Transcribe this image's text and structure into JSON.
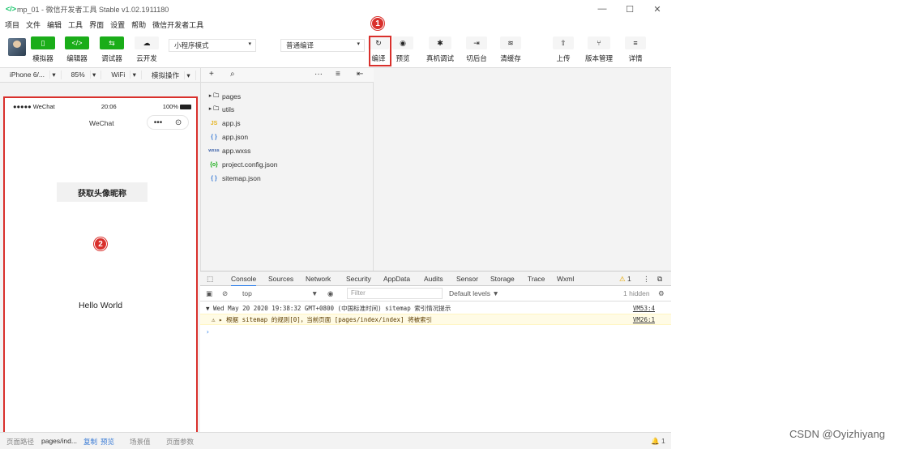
{
  "window": {
    "title": "mp_01 - 微信开发者工具 Stable v1.02.1911180",
    "logo": "</>",
    "controls": [
      "—",
      "☐",
      "✕"
    ]
  },
  "menu": [
    "项目",
    "文件",
    "编辑",
    "工具",
    "界面",
    "设置",
    "帮助",
    "微信开发者工具"
  ],
  "toolbar": {
    "buttons": [
      {
        "label": "模拟器",
        "icon": "phone-icon",
        "glyph": "▯"
      },
      {
        "label": "编辑器",
        "icon": "code-icon",
        "glyph": "</>"
      },
      {
        "label": "调试器",
        "icon": "debug-icon",
        "glyph": "⇆"
      },
      {
        "label": "云开发",
        "icon": "cloud-icon",
        "glyph": "☁"
      }
    ],
    "mode_select": "小程序模式",
    "compile_select": "普通编译",
    "actions": [
      {
        "label": "编译",
        "icon": "refresh-icon",
        "glyph": "↻"
      },
      {
        "label": "预览",
        "icon": "eye-icon",
        "glyph": "◉"
      },
      {
        "label": "真机调试",
        "icon": "bug-icon",
        "glyph": "✱"
      },
      {
        "label": "切后台",
        "icon": "switch-icon",
        "glyph": "⇥"
      },
      {
        "label": "清缓存",
        "icon": "layers-icon",
        "glyph": "≋"
      },
      {
        "label": "上传",
        "icon": "upload-icon",
        "glyph": "⇧"
      },
      {
        "label": "版本管理",
        "icon": "branch-icon",
        "glyph": "⑂"
      },
      {
        "label": "详情",
        "icon": "menu-icon",
        "glyph": "≡"
      }
    ]
  },
  "annotations": [
    "1",
    "2"
  ],
  "simulator": {
    "device": "iPhone 6/...",
    "zoom": "85%",
    "network": "WiFi",
    "sim_ops": "模拟操作",
    "status_carrier": "●●●●● WeChat",
    "status_time": "20:06",
    "status_battery": "100%",
    "nav_title": "WeChat",
    "capsule_more": "•••",
    "capsule_close": "⊙",
    "button_label": "获取头像昵称",
    "hello_text": "Hello World"
  },
  "file_tree": [
    {
      "name": "pages",
      "type": "folder",
      "icon": "▸ 🗀"
    },
    {
      "name": "utils",
      "type": "folder",
      "icon": "▸ 🗀"
    },
    {
      "name": "app.js",
      "type": "js",
      "icon": "JS"
    },
    {
      "name": "app.json",
      "type": "json",
      "icon": "{ }"
    },
    {
      "name": "app.wxss",
      "type": "wxss",
      "icon": "wxss"
    },
    {
      "name": "project.config.json",
      "type": "config",
      "icon": "{o}"
    },
    {
      "name": "sitemap.json",
      "type": "json",
      "icon": "{ }"
    }
  ],
  "devtools": {
    "tabs": [
      "Console",
      "Sources",
      "Network",
      "Security",
      "AppData",
      "Audits",
      "Sensor",
      "Storage",
      "Trace",
      "Wxml"
    ],
    "active_tab": "Console",
    "warning_count": "1",
    "context": "top",
    "filter_placeholder": "Filter",
    "levels": "Default levels ▼",
    "hidden": "1 hidden",
    "logs": [
      {
        "text": "▼ Wed May 20 2020 19:38:32 GMT+0800 (中国标准时间) sitemap 索引情况提示",
        "source": "VM53:4",
        "level": "info"
      },
      {
        "text": "⚠ ▸ 根据 sitemap 的规则[0]，当前页面 [pages/index/index] 将被索引",
        "source": "VM26:1",
        "level": "warn"
      }
    ],
    "prompt": "›"
  },
  "statusbar": {
    "path_label": "页面路径",
    "path_value": "pages/ind...",
    "copy": "复制",
    "preview": "预览",
    "scene": "场景值",
    "params": "页面参数",
    "bell": "🔔 1"
  },
  "watermark": "CSDN @Oyizhiyang",
  "colors": {
    "accent_green": "#1aad19",
    "highlight_red": "#d9302c",
    "active_tab": "#1a73e8"
  }
}
